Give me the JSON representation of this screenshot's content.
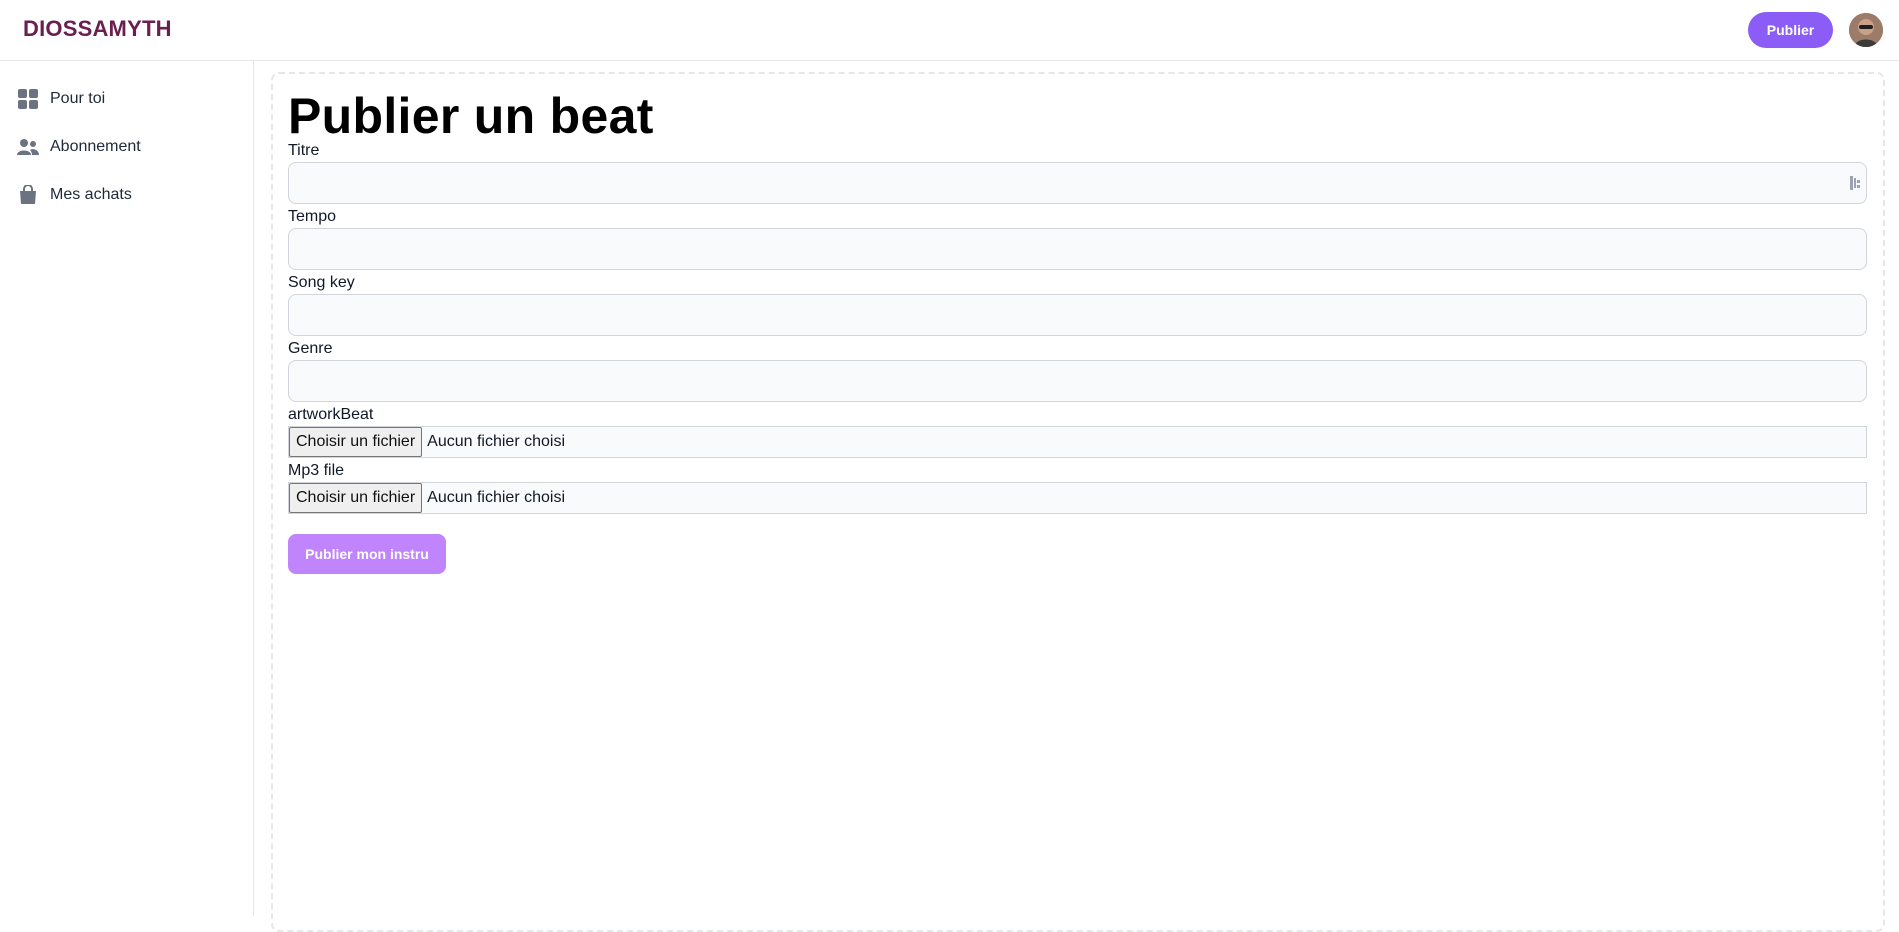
{
  "header": {
    "brand": "DIOSSAMYTH",
    "publish_label": "Publier"
  },
  "sidebar": {
    "items": [
      {
        "label": "Pour toi",
        "icon": "grid-icon"
      },
      {
        "label": "Abonnement",
        "icon": "users-icon"
      },
      {
        "label": "Mes achats",
        "icon": "shopping-bag-icon"
      }
    ]
  },
  "form": {
    "title": "Publier un beat",
    "fields": [
      {
        "label": "Titre",
        "value": ""
      },
      {
        "label": "Tempo",
        "value": ""
      },
      {
        "label": "Song key",
        "value": ""
      },
      {
        "label": "Genre",
        "value": ""
      }
    ],
    "files": [
      {
        "label": "artworkBeat",
        "button": "Choisir un fichier",
        "status": "Aucun fichier choisi"
      },
      {
        "label": "Mp3 file",
        "button": "Choisir un fichier",
        "status": "Aucun fichier choisi"
      }
    ],
    "submit_label": "Publier mon instru"
  },
  "colors": {
    "brand": "#6b1f4f",
    "accent": "#8b5cf6",
    "submit": "#c084fc",
    "icon": "#6b7280"
  }
}
